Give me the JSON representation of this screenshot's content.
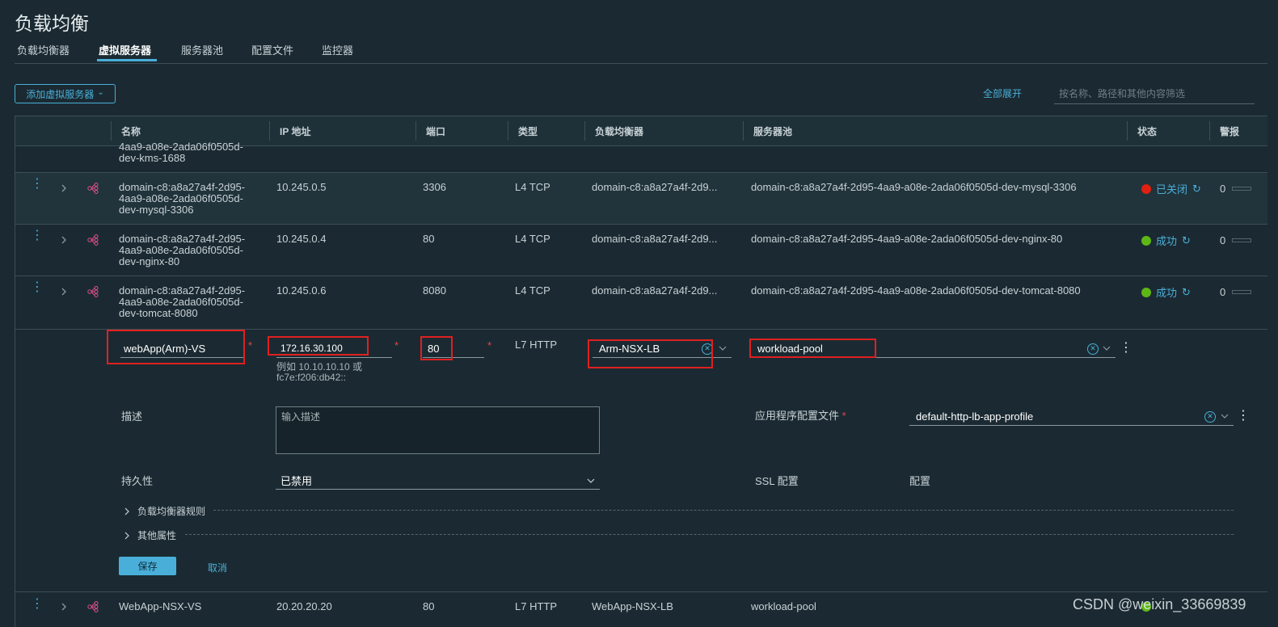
{
  "page": {
    "title": "负载均衡"
  },
  "tabs": [
    {
      "label": "负载均衡器",
      "active": false
    },
    {
      "label": "虚拟服务器",
      "active": true
    },
    {
      "label": "服务器池",
      "active": false
    },
    {
      "label": "配置文件",
      "active": false
    },
    {
      "label": "监控器",
      "active": false
    }
  ],
  "toolbar": {
    "add_button_label": "添加虚拟服务器",
    "add_button_caret": "⌄",
    "expand_all_label": "全部展开",
    "filter_placeholder": "按名称、路径和其他内容筛选"
  },
  "table": {
    "headers": [
      "名称",
      "IP 地址",
      "端口",
      "类型",
      "负载均衡器",
      "服务器池",
      "状态",
      "警报"
    ],
    "partial_row": {
      "name": "4aa9-a08e-2ada06f0505d-\ndev-kms-1688"
    },
    "rows": [
      {
        "name": "domain-c8:a8a27a4f-2d95-\n4aa9-a08e-2ada06f0505d-\ndev-mysql-3306",
        "ip": "10.245.0.5",
        "port": "3306",
        "type": "L4 TCP",
        "lb": "domain-c8:a8a27a4f-2d9...",
        "pool": "domain-c8:a8a27a4f-2d95-4aa9-a08e-2ada06f0505d-dev-mysql-3306",
        "status": "已关闭",
        "status_color": "#e02010",
        "alarm": "0"
      },
      {
        "name": "domain-c8:a8a27a4f-2d95-\n4aa9-a08e-2ada06f0505d-\ndev-nginx-80",
        "ip": "10.245.0.4",
        "port": "80",
        "type": "L4 TCP",
        "lb": "domain-c8:a8a27a4f-2d9...",
        "pool": "domain-c8:a8a27a4f-2d95-4aa9-a08e-2ada06f0505d-dev-nginx-80",
        "status": "成功",
        "status_color": "#5eb715",
        "alarm": "0"
      },
      {
        "name": "domain-c8:a8a27a4f-2d95-\n4aa9-a08e-2ada06f0505d-\ndev-tomcat-8080",
        "ip": "10.245.0.6",
        "port": "8080",
        "type": "L4 TCP",
        "lb": "domain-c8:a8a27a4f-2d9...",
        "pool": "domain-c8:a8a27a4f-2d95-4aa9-a08e-2ada06f0505d-dev-tomcat-8080",
        "status": "成功",
        "status_color": "#5eb715",
        "alarm": "0"
      }
    ],
    "last_row": {
      "name": "WebApp-NSX-VS",
      "ip": "20.20.20.20",
      "port": "80",
      "type": "L7 HTTP",
      "lb": "WebApp-NSX-LB",
      "pool": "workload-pool"
    }
  },
  "edit": {
    "name_value": "webApp(Arm)-VS",
    "ip_value": "172.16.30.100",
    "ip_hint": "例如 10.10.10.10 或\nfc7e:f206:db42::",
    "port_value": "80",
    "type_value": "L7 HTTP",
    "lb_value": "Arm-NSX-LB",
    "pool_value": "workload-pool",
    "required_mark": "*",
    "description_label": "描述",
    "description_placeholder": "输入描述",
    "app_profile_label": "应用程序配置文件",
    "app_profile_value": "default-http-lb-app-profile",
    "persistence_label": "持久性",
    "persistence_value": "已禁用",
    "ssl_label": "SSL 配置",
    "ssl_link": "配置",
    "lb_rules_label": "负载均衡器规则",
    "other_props_label": "其他属性",
    "save_label": "保存",
    "cancel_label": "取消"
  },
  "watermark": "CSDN @weixin_33669839",
  "colors": {
    "accent": "#49afd9",
    "background": "#1b2a32",
    "highlight_box": "#e02020"
  }
}
